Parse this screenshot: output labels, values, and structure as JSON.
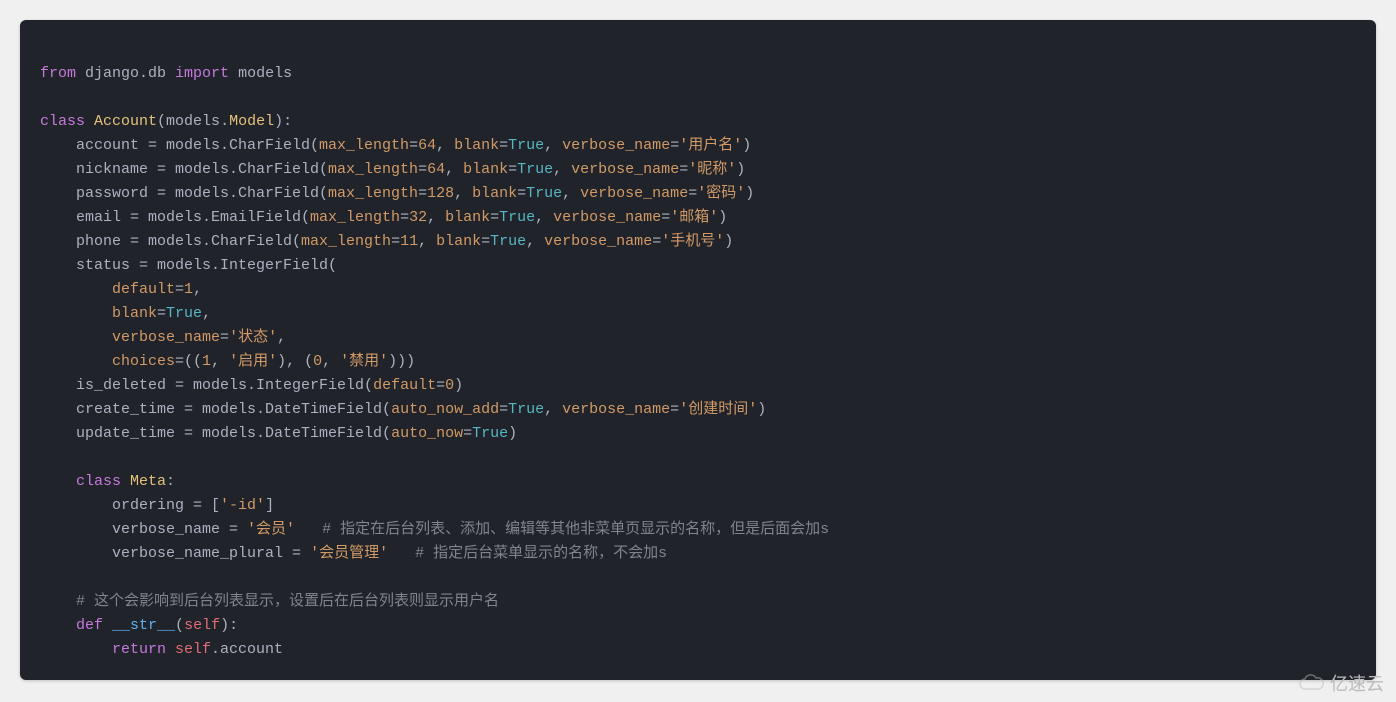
{
  "code": {
    "l1": {
      "from": "from",
      "sp": " ",
      "mod": "django.db ",
      "imp": "import ",
      "models": "models"
    },
    "l3": {
      "cls": "class ",
      "name": "Account",
      "op": "(",
      "base1": "models",
      "dot": ".",
      "base2": "Model",
      "cl": "):"
    },
    "l4": {
      "attr": "    account = models.CharField(",
      "p1": "max_length",
      "eq1": "=",
      "v1": "64",
      "c1": ", ",
      "p2": "blank",
      "eq2": "=",
      "v2": "True",
      "c2": ", ",
      "p3": "verbose_name",
      "eq3": "=",
      "v3": "'用户名'",
      "end": ")"
    },
    "l5": {
      "attr": "    nickname = models.CharField(",
      "p1": "max_length",
      "eq1": "=",
      "v1": "64",
      "c1": ", ",
      "p2": "blank",
      "eq2": "=",
      "v2": "True",
      "c2": ", ",
      "p3": "verbose_name",
      "eq3": "=",
      "v3": "'昵称'",
      "end": ")"
    },
    "l6": {
      "attr": "    password = models.CharField(",
      "p1": "max_length",
      "eq1": "=",
      "v1": "128",
      "c1": ", ",
      "p2": "blank",
      "eq2": "=",
      "v2": "True",
      "c2": ", ",
      "p3": "verbose_name",
      "eq3": "=",
      "v3": "'密码'",
      "end": ")"
    },
    "l7": {
      "attr": "    email = models.EmailField(",
      "p1": "max_length",
      "eq1": "=",
      "v1": "32",
      "c1": ", ",
      "p2": "blank",
      "eq2": "=",
      "v2": "True",
      "c2": ", ",
      "p3": "verbose_name",
      "eq3": "=",
      "v3": "'邮箱'",
      "end": ")"
    },
    "l8": {
      "attr": "    phone = models.CharField(",
      "p1": "max_length",
      "eq1": "=",
      "v1": "11",
      "c1": ", ",
      "p2": "blank",
      "eq2": "=",
      "v2": "True",
      "c2": ", ",
      "p3": "verbose_name",
      "eq3": "=",
      "v3": "'手机号'",
      "end": ")"
    },
    "l9": {
      "attr": "    status = models.IntegerField("
    },
    "l10": {
      "pad": "        ",
      "p": "default",
      "eq": "=",
      "v": "1",
      "c": ","
    },
    "l11": {
      "pad": "        ",
      "p": "blank",
      "eq": "=",
      "v": "True",
      "c": ","
    },
    "l12": {
      "pad": "        ",
      "p": "verbose_name",
      "eq": "=",
      "v": "'状态'",
      "c": ","
    },
    "l13": {
      "pad": "        ",
      "p": "choices",
      "eq": "=((",
      "v1": "1",
      "c1": ", ",
      "s1": "'启用'",
      "mid": "), (",
      "v2": "0",
      "c2": ", ",
      "s2": "'禁用'",
      "end": ")))"
    },
    "l14": {
      "attr": "    is_deleted = models.IntegerField(",
      "p": "default",
      "eq": "=",
      "v": "0",
      "end": ")"
    },
    "l15": {
      "attr": "    create_time = models.DateTimeField(",
      "p1": "auto_now_add",
      "eq1": "=",
      "v1": "True",
      "c1": ", ",
      "p2": "verbose_name",
      "eq2": "=",
      "v2": "'创建时间'",
      "end": ")"
    },
    "l16": {
      "attr": "    update_time = models.DateTimeField(",
      "p1": "auto_now",
      "eq1": "=",
      "v1": "True",
      "end": ")"
    },
    "l18": {
      "pad": "    ",
      "cls": "class ",
      "name": "Meta",
      "end": ":"
    },
    "l19": {
      "pad": "        ",
      "attr": "ordering = [",
      "s": "'-id'",
      "end": "]"
    },
    "l20": {
      "pad": "        ",
      "attr": "verbose_name = ",
      "s": "'会员'",
      "sp": "   ",
      "cmt": "# 指定在后台列表、添加、编辑等其他非菜单页显示的名称，但是后面会加s"
    },
    "l21": {
      "pad": "        ",
      "attr": "verbose_name_plural = ",
      "s": "'会员管理'",
      "sp": "   ",
      "cmt": "# 指定后台菜单显示的名称，不会加s"
    },
    "l23": {
      "pad": "    ",
      "cmt": "# 这个会影响到后台列表显示，设置后在后台列表则显示用户名"
    },
    "l24": {
      "pad": "    ",
      "def": "def ",
      "name": "__str__",
      "op": "(",
      "self": "self",
      "end": "):"
    },
    "l25": {
      "pad": "        ",
      "ret": "return ",
      "self": "self",
      "dot": ".account"
    }
  },
  "watermark": "亿速云"
}
